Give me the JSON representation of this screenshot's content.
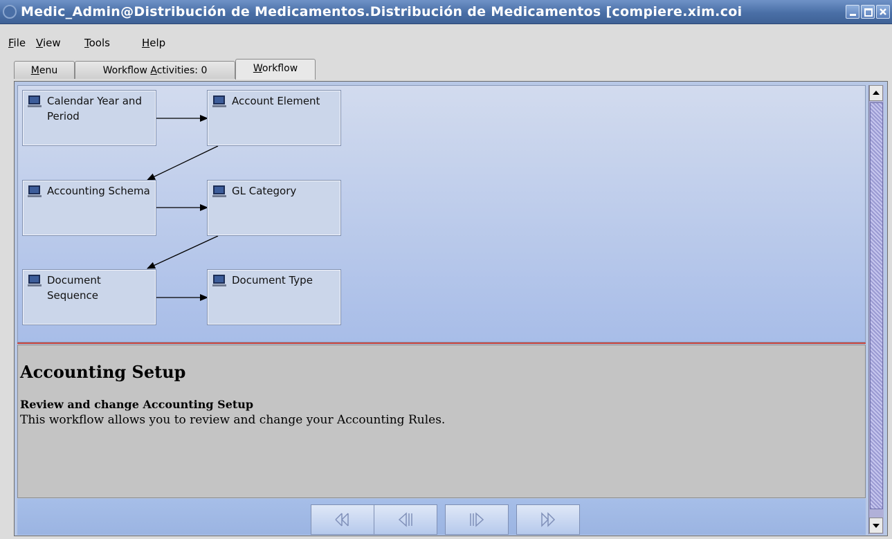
{
  "window": {
    "title": "Medic_Admin@Distribución de Medicamentos.Distribución de Medicamentos [compiere.xim.coi"
  },
  "menubar": {
    "file": {
      "mnemonic": "F",
      "rest": "ile"
    },
    "view": {
      "mnemonic": "V",
      "rest": "iew"
    },
    "tools": {
      "mnemonic": "T",
      "rest": "ools"
    },
    "help": {
      "mnemonic": "H",
      "rest": "elp"
    }
  },
  "tabs": {
    "menu": {
      "mnemonic": "M",
      "rest": "enu"
    },
    "activities": {
      "pre": "Workflow ",
      "mnemonic": "A",
      "rest": "ctivities: 0"
    },
    "workflow": {
      "mnemonic": "W",
      "rest": "orkflow"
    }
  },
  "workflow_nodes": [
    {
      "id": "calendar",
      "label": "Calendar Year and Period",
      "icon": "window-icon"
    },
    {
      "id": "account-element",
      "label": "Account Element",
      "icon": "window-icon"
    },
    {
      "id": "accounting-schema",
      "label": "Accounting Schema",
      "icon": "window-icon"
    },
    {
      "id": "gl-category",
      "label": "GL Category",
      "icon": "window-icon"
    },
    {
      "id": "document-sequence",
      "label": "Document Sequence",
      "icon": "window-icon"
    },
    {
      "id": "document-type",
      "label": "Document Type",
      "icon": "window-icon"
    }
  ],
  "description": {
    "title": "Accounting Setup",
    "subtitle": "Review and change Accounting Setup",
    "text": "This workflow allows you to review and change your Accounting Rules."
  },
  "navigation": [
    "first-icon",
    "previous-icon",
    "next-icon",
    "last-icon"
  ],
  "colors": {
    "title_bar": "#4a6fa6",
    "graph_background": "#b8c8ec",
    "separator": "#c8443a",
    "description_background": "#c4c4c4"
  }
}
